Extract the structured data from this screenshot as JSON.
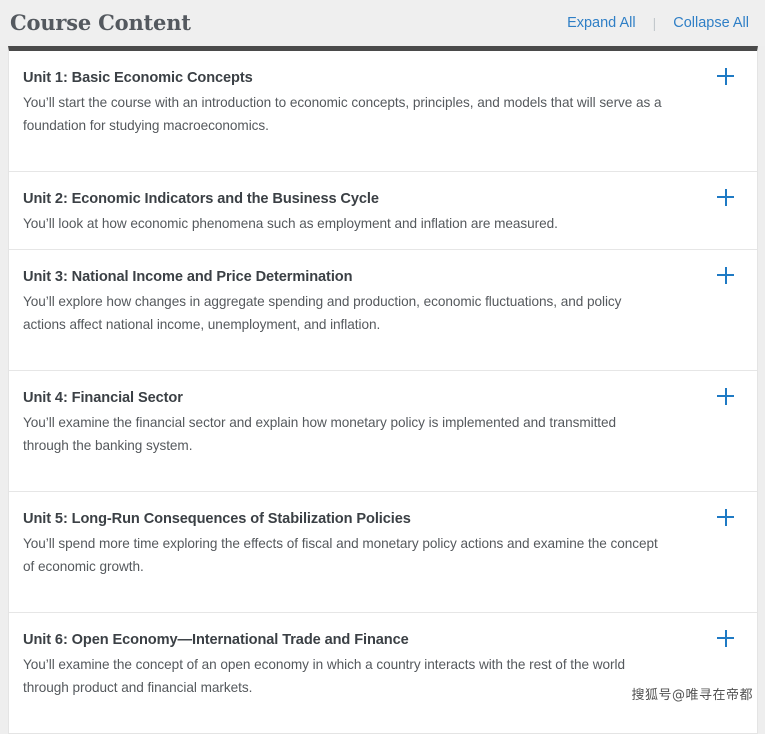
{
  "header": {
    "title": "Course Content",
    "expand_all_label": "Expand All",
    "separator": "|",
    "collapse_all_label": "Collapse All"
  },
  "units": [
    {
      "title": "Unit 1: Basic Economic Concepts",
      "description": "You’ll start the course with an introduction to economic concepts, principles, and models that will serve as a foundation for studying macroeconomics.",
      "toggle": "plus-icon"
    },
    {
      "title": "Unit 2: Economic Indicators and the Business Cycle",
      "description": "You’ll look at how economic phenomena such as employment and inflation are measured.",
      "toggle": "plus-icon"
    },
    {
      "title": "Unit 3: National Income and Price Determination",
      "description": "You’ll explore how changes in aggregate spending and production, economic fluctuations, and policy actions affect national income, unemployment, and inflation.",
      "toggle": "plus-icon"
    },
    {
      "title": "Unit 4: Financial Sector",
      "description": "You’ll examine the financial sector and explain how monetary policy is implemented and transmitted through the banking system.",
      "toggle": "plus-icon"
    },
    {
      "title": "Unit 5: Long-Run Consequences of Stabilization Policies",
      "description": "You’ll spend more time exploring the effects of fiscal and monetary policy actions and examine the concept of economic growth.",
      "toggle": "plus-icon"
    },
    {
      "title": "Unit 6: Open Economy—International Trade and Finance",
      "description": "You’ll examine the concept of an open economy in which a country interacts with the rest of the world through product and financial markets.",
      "toggle": "plus-icon"
    }
  ],
  "watermark": {
    "text": "搜狐号@唯寻在帝都"
  },
  "colors": {
    "link": "#2f7fc6",
    "accent_plus": "#1f7ac4",
    "top_bar": "#4a4a4a",
    "page_background": "#eeeeee",
    "panel_background": "#ffffff",
    "title_text": "#54595f",
    "body_text": "#55595d"
  }
}
